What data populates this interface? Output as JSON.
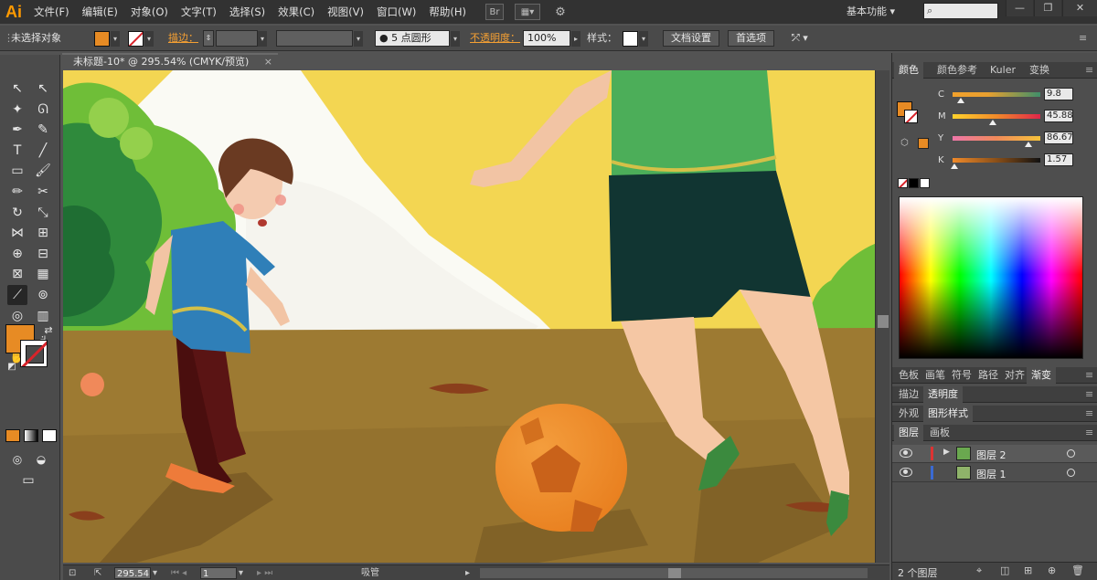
{
  "app": {
    "logo": "Ai"
  },
  "menu": [
    "文件(F)",
    "编辑(E)",
    "对象(O)",
    "文字(T)",
    "选择(S)",
    "效果(C)",
    "视图(V)",
    "窗口(W)",
    "帮助(H)"
  ],
  "menubar": {
    "bridge_label": "Br",
    "arrange_label": "▦▾",
    "workspace": "基本功能 ▾",
    "search_icon": "⌕",
    "minimize": "—",
    "restore": "❐",
    "close": "✕"
  },
  "control": {
    "selection_state": "未选择对象",
    "fill_color": "#e78b24",
    "stroke_label": "描边：",
    "brush_label": "5 点圆形",
    "opacity_label": "不透明度：",
    "opacity_value": "100%",
    "style_label": "样式：",
    "doc_setup": "文档设置",
    "preferences": "首选项"
  },
  "document": {
    "tab_title": "未标题-10* @ 295.54% (CMYK/预览)",
    "close_glyph": "×",
    "zoom": "295.54",
    "artboard": "1",
    "status_tool": "吸管"
  },
  "toolbox": {
    "tools": [
      {
        "name": "selection-tool",
        "glyph": "↖"
      },
      {
        "name": "direct-selection-tool",
        "glyph": "↖"
      },
      {
        "name": "magic-wand-tool",
        "glyph": "✦"
      },
      {
        "name": "lasso-tool",
        "glyph": "ᘏ"
      },
      {
        "name": "pen-tool",
        "glyph": "✒"
      },
      {
        "name": "curvature-tool",
        "glyph": "✎"
      },
      {
        "name": "type-tool",
        "glyph": "T"
      },
      {
        "name": "line-tool",
        "glyph": "╱"
      },
      {
        "name": "rectangle-tool",
        "glyph": "▭"
      },
      {
        "name": "paintbrush-tool",
        "glyph": "🖌"
      },
      {
        "name": "pencil-tool",
        "glyph": "✏"
      },
      {
        "name": "scissors-tool",
        "glyph": "✂"
      },
      {
        "name": "rotate-tool",
        "glyph": "↻"
      },
      {
        "name": "scale-tool",
        "glyph": "⤡"
      },
      {
        "name": "width-tool",
        "glyph": "⋈"
      },
      {
        "name": "free-transform-tool",
        "glyph": "⊞"
      },
      {
        "name": "shape-builder-tool",
        "glyph": "⊕"
      },
      {
        "name": "perspective-grid-tool",
        "glyph": "⊟"
      },
      {
        "name": "mesh-tool",
        "glyph": "⊠"
      },
      {
        "name": "gradient-tool",
        "glyph": "▦"
      },
      {
        "name": "eyedropper-tool",
        "glyph": "⟋"
      },
      {
        "name": "blend-tool",
        "glyph": "⊚"
      },
      {
        "name": "symbol-sprayer-tool",
        "glyph": "◎"
      },
      {
        "name": "column-graph-tool",
        "glyph": "▥"
      },
      {
        "name": "artboard-tool",
        "glyph": "⌗"
      },
      {
        "name": "slice-tool",
        "glyph": "⟓"
      },
      {
        "name": "hand-tool",
        "glyph": "✋"
      },
      {
        "name": "zoom-tool",
        "glyph": "⚲"
      }
    ],
    "fill_color": "#e78b24"
  },
  "color_panel": {
    "tabs": [
      "颜色",
      "颜色参考",
      "Kuler",
      "变换"
    ],
    "channels": [
      {
        "label": "C",
        "value": "9.8",
        "pos": 0.098,
        "bar": "linear-gradient(to right,#f2a12c,#e8a030 40%,#3f8f6a)"
      },
      {
        "label": "M",
        "value": "45.88",
        "pos": 0.4588,
        "bar": "linear-gradient(to right,#ffd22c,#f08a2a 50%,#e0254a)"
      },
      {
        "label": "Y",
        "value": "86.67",
        "pos": 0.8667,
        "bar": "linear-gradient(to right,#ee76a8,#f08a5a 50%,#f5c23a)"
      },
      {
        "label": "K",
        "value": "1.57",
        "pos": 0.0157,
        "bar": "linear-gradient(to right,#f08a2a,#8a4f18 50%,#111)"
      }
    ]
  },
  "swatch_tabs": [
    "色板",
    "画笔",
    "符号",
    "路径",
    "对齐",
    "渐变"
  ],
  "appearance_tabs": [
    "描边",
    "透明度"
  ],
  "style_tabs": [
    "外观",
    "图形样式"
  ],
  "layers_panel": {
    "tabs": [
      "图层",
      "画板"
    ],
    "layers": [
      {
        "name": "图层 2",
        "color": "#d33"
      },
      {
        "name": "图层 1",
        "color": "#3a6ad3"
      }
    ],
    "count": "2 个图层"
  }
}
